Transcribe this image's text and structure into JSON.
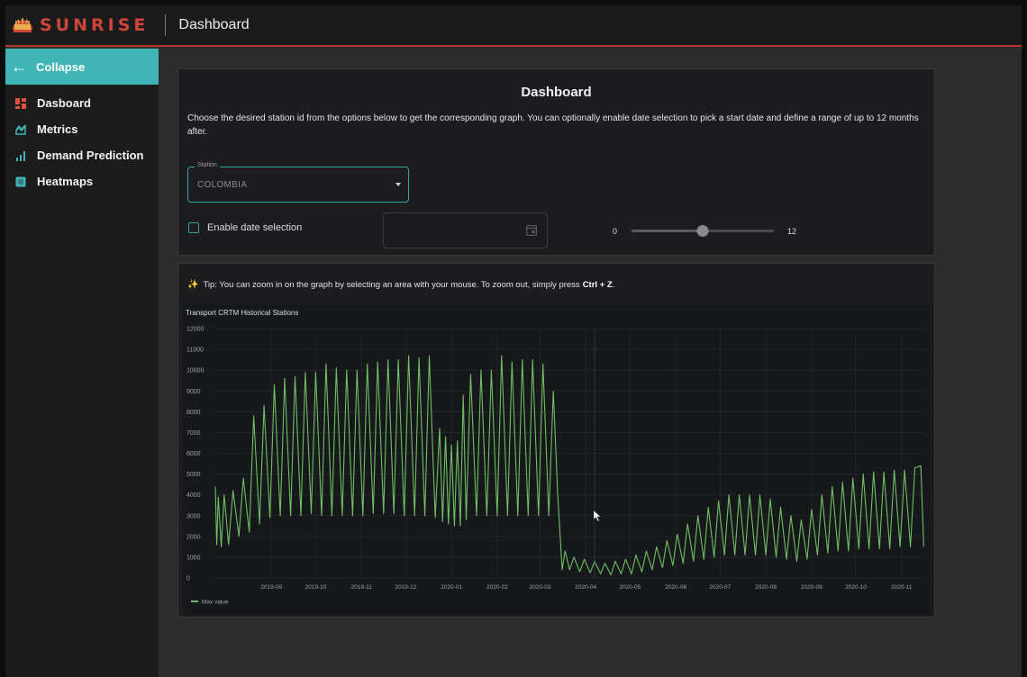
{
  "header": {
    "brand": "SUNRISE",
    "title": "Dashboard"
  },
  "sidebar": {
    "collapse_label": "Collapse",
    "items": [
      {
        "label": "Dasboard",
        "icon": "dashboard-grid-icon",
        "icon_color": "#e0523e"
      },
      {
        "label": "Metrics",
        "icon": "metrics-icon",
        "icon_color": "#3fb6b5"
      },
      {
        "label": "Demand Prediction",
        "icon": "bar-chart-icon",
        "icon_color": "#3fb6b5"
      },
      {
        "label": "Heatmaps",
        "icon": "heatmap-icon",
        "icon_color": "#3fb6b5"
      }
    ]
  },
  "dashboard": {
    "heading": "Dashboard",
    "description": "Choose the desired station id from the options below to get the corresponding graph. You can optionally enable date selection to pick a start date and define a range of up to 12 months after.",
    "station_label": "Station",
    "station_value": "COLOMBIA",
    "date_checkbox_label": "Enable date selection",
    "date_checkbox_checked": false,
    "slider_min": "0",
    "slider_max": "12",
    "slider_value": 6
  },
  "graph_panel": {
    "tip_text": "Tip: You can zoom in on the graph by selecting an area with your mouse. To zoom out, simply press",
    "tip_shortcut": "Ctrl + Z",
    "tip_end": "."
  },
  "chart_data": {
    "type": "line",
    "title": "Transport CRTM Historical Stations",
    "xlabel": "",
    "ylabel": "",
    "ylim": [
      0,
      12000
    ],
    "yticks": [
      0,
      1000,
      2000,
      3000,
      4000,
      5000,
      6000,
      7000,
      8000,
      9000,
      10000,
      11000,
      12000
    ],
    "xlim": [
      "2019-07-25",
      "2020-11-17"
    ],
    "xticks": [
      "2019-09",
      "2019-10",
      "2019-11",
      "2019-12",
      "2020-01",
      "2020-02",
      "2020-03",
      "2020-04",
      "2020-05",
      "2020-06",
      "2020-07",
      "2020-08",
      "2020-09",
      "2020-10",
      "2020-11"
    ],
    "grid": true,
    "legend_position": "bottom-left",
    "color": "#6fbf63",
    "series": [
      {
        "name": "Max value",
        "values": [
          {
            "x": "2019-07-25",
            "y": 4400
          },
          {
            "x": "2019-07-26",
            "y": 1600
          },
          {
            "x": "2019-07-27",
            "y": 3900
          },
          {
            "x": "2019-07-29",
            "y": 1500
          },
          {
            "x": "2019-07-31",
            "y": 4000
          },
          {
            "x": "2019-08-03",
            "y": 1600
          },
          {
            "x": "2019-08-06",
            "y": 4200
          },
          {
            "x": "2019-08-10",
            "y": 2000
          },
          {
            "x": "2019-08-13",
            "y": 4800
          },
          {
            "x": "2019-08-17",
            "y": 2200
          },
          {
            "x": "2019-08-20",
            "y": 7800
          },
          {
            "x": "2019-08-24",
            "y": 2600
          },
          {
            "x": "2019-08-27",
            "y": 8300
          },
          {
            "x": "2019-08-31",
            "y": 2900
          },
          {
            "x": "2019-09-03",
            "y": 9300
          },
          {
            "x": "2019-09-07",
            "y": 3000
          },
          {
            "x": "2019-09-10",
            "y": 9600
          },
          {
            "x": "2019-09-14",
            "y": 3000
          },
          {
            "x": "2019-09-17",
            "y": 9700
          },
          {
            "x": "2019-09-21",
            "y": 3000
          },
          {
            "x": "2019-09-24",
            "y": 9900
          },
          {
            "x": "2019-09-28",
            "y": 3100
          },
          {
            "x": "2019-10-01",
            "y": 9900
          },
          {
            "x": "2019-10-05",
            "y": 3000
          },
          {
            "x": "2019-10-08",
            "y": 10300
          },
          {
            "x": "2019-10-12",
            "y": 3000
          },
          {
            "x": "2019-10-15",
            "y": 10100
          },
          {
            "x": "2019-10-19",
            "y": 3000
          },
          {
            "x": "2019-10-22",
            "y": 10000
          },
          {
            "x": "2019-10-26",
            "y": 3000
          },
          {
            "x": "2019-10-29",
            "y": 10000
          },
          {
            "x": "2019-11-02",
            "y": 3000
          },
          {
            "x": "2019-11-05",
            "y": 10300
          },
          {
            "x": "2019-11-09",
            "y": 3100
          },
          {
            "x": "2019-11-12",
            "y": 10400
          },
          {
            "x": "2019-11-16",
            "y": 3100
          },
          {
            "x": "2019-11-19",
            "y": 10500
          },
          {
            "x": "2019-11-23",
            "y": 3100
          },
          {
            "x": "2019-11-26",
            "y": 10500
          },
          {
            "x": "2019-11-30",
            "y": 3000
          },
          {
            "x": "2019-12-03",
            "y": 10700
          },
          {
            "x": "2019-12-07",
            "y": 3000
          },
          {
            "x": "2019-12-10",
            "y": 10600
          },
          {
            "x": "2019-12-14",
            "y": 3000
          },
          {
            "x": "2019-12-17",
            "y": 10700
          },
          {
            "x": "2019-12-21",
            "y": 2900
          },
          {
            "x": "2019-12-24",
            "y": 7200
          },
          {
            "x": "2019-12-26",
            "y": 2700
          },
          {
            "x": "2019-12-28",
            "y": 6800
          },
          {
            "x": "2019-12-30",
            "y": 2600
          },
          {
            "x": "2020-01-01",
            "y": 6400
          },
          {
            "x": "2020-01-03",
            "y": 2500
          },
          {
            "x": "2020-01-05",
            "y": 6600
          },
          {
            "x": "2020-01-07",
            "y": 2500
          },
          {
            "x": "2020-01-09",
            "y": 8800
          },
          {
            "x": "2020-01-11",
            "y": 2800
          },
          {
            "x": "2020-01-14",
            "y": 9800
          },
          {
            "x": "2020-01-18",
            "y": 3000
          },
          {
            "x": "2020-01-21",
            "y": 10000
          },
          {
            "x": "2020-01-25",
            "y": 3000
          },
          {
            "x": "2020-01-28",
            "y": 10000
          },
          {
            "x": "2020-02-01",
            "y": 3000
          },
          {
            "x": "2020-02-04",
            "y": 10700
          },
          {
            "x": "2020-02-08",
            "y": 3000
          },
          {
            "x": "2020-02-11",
            "y": 10400
          },
          {
            "x": "2020-02-15",
            "y": 3000
          },
          {
            "x": "2020-02-18",
            "y": 10500
          },
          {
            "x": "2020-02-22",
            "y": 3000
          },
          {
            "x": "2020-02-25",
            "y": 10500
          },
          {
            "x": "2020-02-29",
            "y": 3000
          },
          {
            "x": "2020-03-03",
            "y": 10300
          },
          {
            "x": "2020-03-07",
            "y": 3000
          },
          {
            "x": "2020-03-10",
            "y": 9000
          },
          {
            "x": "2020-03-13",
            "y": 4000
          },
          {
            "x": "2020-03-16",
            "y": 400
          },
          {
            "x": "2020-03-18",
            "y": 1300
          },
          {
            "x": "2020-03-21",
            "y": 400
          },
          {
            "x": "2020-03-24",
            "y": 1000
          },
          {
            "x": "2020-03-28",
            "y": 300
          },
          {
            "x": "2020-03-31",
            "y": 900
          },
          {
            "x": "2020-04-04",
            "y": 250
          },
          {
            "x": "2020-04-07",
            "y": 800
          },
          {
            "x": "2020-04-11",
            "y": 200
          },
          {
            "x": "2020-04-14",
            "y": 700
          },
          {
            "x": "2020-04-18",
            "y": 150
          },
          {
            "x": "2020-04-21",
            "y": 800
          },
          {
            "x": "2020-04-25",
            "y": 200
          },
          {
            "x": "2020-04-28",
            "y": 900
          },
          {
            "x": "2020-05-02",
            "y": 200
          },
          {
            "x": "2020-05-05",
            "y": 1100
          },
          {
            "x": "2020-05-09",
            "y": 300
          },
          {
            "x": "2020-05-12",
            "y": 1300
          },
          {
            "x": "2020-05-16",
            "y": 400
          },
          {
            "x": "2020-05-19",
            "y": 1500
          },
          {
            "x": "2020-05-23",
            "y": 500
          },
          {
            "x": "2020-05-26",
            "y": 1800
          },
          {
            "x": "2020-05-30",
            "y": 600
          },
          {
            "x": "2020-06-02",
            "y": 2100
          },
          {
            "x": "2020-06-06",
            "y": 700
          },
          {
            "x": "2020-06-09",
            "y": 2600
          },
          {
            "x": "2020-06-13",
            "y": 800
          },
          {
            "x": "2020-06-16",
            "y": 3000
          },
          {
            "x": "2020-06-20",
            "y": 900
          },
          {
            "x": "2020-06-23",
            "y": 3400
          },
          {
            "x": "2020-06-27",
            "y": 1000
          },
          {
            "x": "2020-06-30",
            "y": 3700
          },
          {
            "x": "2020-07-04",
            "y": 1100
          },
          {
            "x": "2020-07-07",
            "y": 4000
          },
          {
            "x": "2020-07-11",
            "y": 1100
          },
          {
            "x": "2020-07-14",
            "y": 4000
          },
          {
            "x": "2020-07-18",
            "y": 1100
          },
          {
            "x": "2020-07-21",
            "y": 4000
          },
          {
            "x": "2020-07-25",
            "y": 1100
          },
          {
            "x": "2020-07-28",
            "y": 4000
          },
          {
            "x": "2020-08-01",
            "y": 1100
          },
          {
            "x": "2020-08-04",
            "y": 3800
          },
          {
            "x": "2020-08-08",
            "y": 1000
          },
          {
            "x": "2020-08-11",
            "y": 3400
          },
          {
            "x": "2020-08-15",
            "y": 900
          },
          {
            "x": "2020-08-18",
            "y": 3000
          },
          {
            "x": "2020-08-22",
            "y": 800
          },
          {
            "x": "2020-08-25",
            "y": 2800
          },
          {
            "x": "2020-08-29",
            "y": 900
          },
          {
            "x": "2020-09-01",
            "y": 3300
          },
          {
            "x": "2020-09-05",
            "y": 1100
          },
          {
            "x": "2020-09-08",
            "y": 4000
          },
          {
            "x": "2020-09-12",
            "y": 1200
          },
          {
            "x": "2020-09-15",
            "y": 4400
          },
          {
            "x": "2020-09-19",
            "y": 1300
          },
          {
            "x": "2020-09-22",
            "y": 4600
          },
          {
            "x": "2020-09-26",
            "y": 1300
          },
          {
            "x": "2020-09-29",
            "y": 4800
          },
          {
            "x": "2020-10-03",
            "y": 1400
          },
          {
            "x": "2020-10-06",
            "y": 5000
          },
          {
            "x": "2020-10-10",
            "y": 1400
          },
          {
            "x": "2020-10-13",
            "y": 5100
          },
          {
            "x": "2020-10-17",
            "y": 1400
          },
          {
            "x": "2020-10-20",
            "y": 5100
          },
          {
            "x": "2020-10-24",
            "y": 1400
          },
          {
            "x": "2020-10-27",
            "y": 5200
          },
          {
            "x": "2020-10-31",
            "y": 1500
          },
          {
            "x": "2020-11-03",
            "y": 5200
          },
          {
            "x": "2020-11-07",
            "y": 1500
          },
          {
            "x": "2020-11-10",
            "y": 5300
          },
          {
            "x": "2020-11-14",
            "y": 5400
          },
          {
            "x": "2020-11-16",
            "y": 1500
          }
        ]
      }
    ]
  }
}
